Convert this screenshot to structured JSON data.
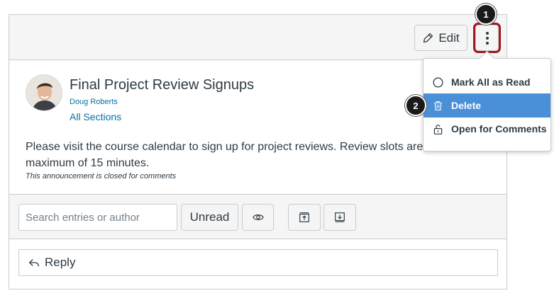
{
  "post": {
    "title": "Final Project Review Signups",
    "author": "Doug Roberts",
    "sections": "All Sections",
    "message": "Please visit the course calendar to sign up for project reviews. Review slots are li",
    "message_line2": "maximum of 15 minutes.",
    "closed_note": "This announcement is closed for comments"
  },
  "header": {
    "edit_label": "Edit",
    "options_icon": "kebab-vertical-icon"
  },
  "menu": {
    "items": [
      {
        "label": "Mark All as Read",
        "icon": "circle-icon"
      },
      {
        "label": "Delete",
        "icon": "trash-icon",
        "highlighted": true
      },
      {
        "label": "Open for Comments",
        "icon": "unlock-icon"
      }
    ]
  },
  "toolbar": {
    "search_placeholder": "Search entries or author",
    "unread_label": "Unread",
    "buttons": [
      "eye-icon",
      "collapse-icon",
      "expand-icon"
    ]
  },
  "reply": {
    "label": "Reply"
  },
  "callouts": [
    "1",
    "2"
  ],
  "colors": {
    "accent": "#4a90d9",
    "link": "#0770a3",
    "highlight_ring": "#a4161d",
    "text": "#2d3b45"
  }
}
